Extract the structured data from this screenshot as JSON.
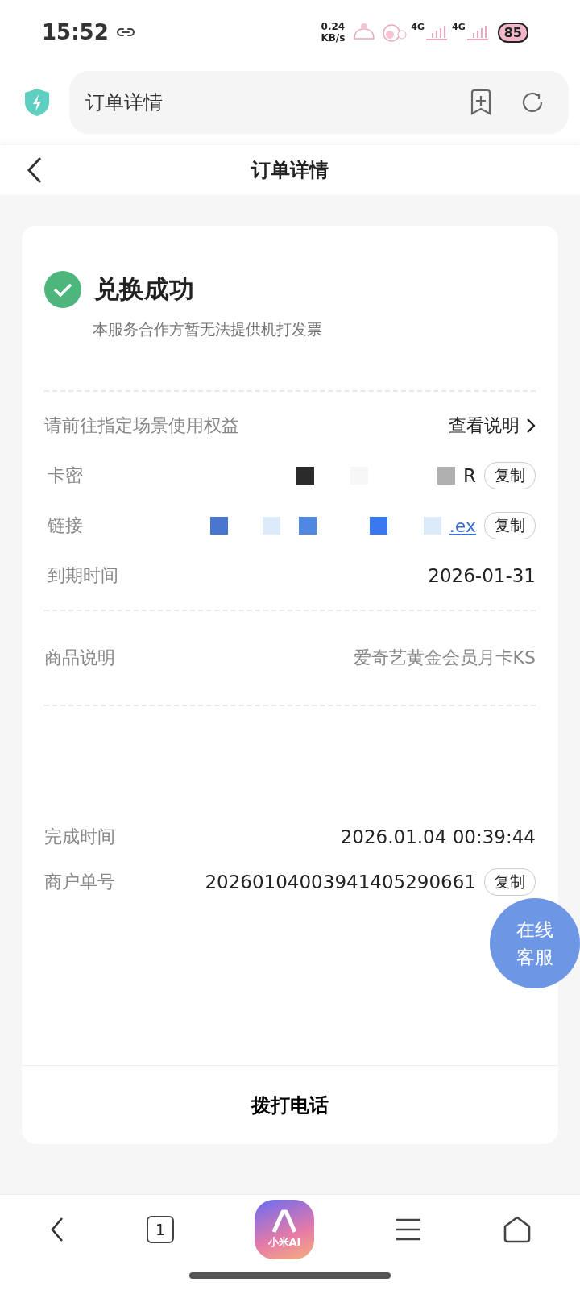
{
  "status_bar": {
    "time": "15:52",
    "speed_value": "0.24",
    "speed_unit": "KB/s",
    "network_1": "4G",
    "network_2": "4G",
    "battery": "85"
  },
  "address_bar": {
    "title": "订单详情"
  },
  "header": {
    "title": "订单详情"
  },
  "result": {
    "title": "兑换成功",
    "note": "本服务合作方暂无法提供机打发票"
  },
  "usage": {
    "hint": "请前往指定场景使用权益",
    "link": "查看说明"
  },
  "rows": [
    {
      "kind": "secret",
      "label": "卡密",
      "value": "R",
      "action": "复制"
    },
    {
      "kind": "link",
      "label": "链接",
      "value": ".ex",
      "action": "复制"
    },
    {
      "kind": "plain",
      "label": "到期时间",
      "value": "2026-01-31"
    }
  ],
  "product": {
    "label": "商品说明",
    "value": "爱奇艺黄金会员月卡KS"
  },
  "info": [
    {
      "label": "完成时间",
      "value": "2026.01.04 00:39:44"
    },
    {
      "label": "商户单号",
      "value": "20260104003941405290661",
      "action": "复制"
    }
  ],
  "call_button": "拨打电话",
  "support_button": [
    "在线",
    "客服"
  ],
  "bottom_nav": {
    "tabs_count": "1",
    "ai_label": "小米AI"
  }
}
